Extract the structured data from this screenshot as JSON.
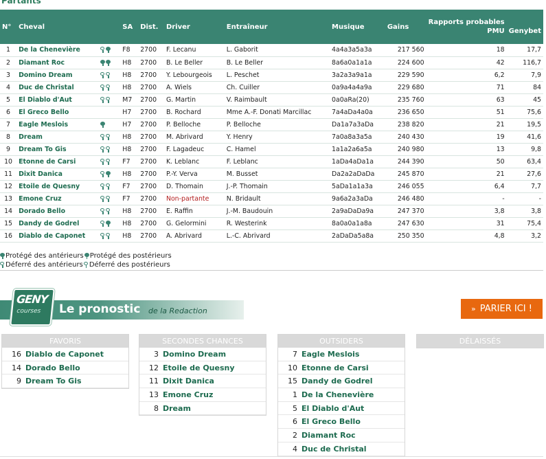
{
  "section_title": "Partants",
  "headers": {
    "num": "N°",
    "name": "Cheval",
    "sa": "SA",
    "dist": "Dist.",
    "driver": "Driver",
    "trainer": "Entraîneur",
    "musique": "Musique",
    "gains": "Gains",
    "rapports": "Rapports probables",
    "pmu": "PMU",
    "genybet": "Genybet"
  },
  "runners": [
    {
      "num": "1",
      "name": "De la Chenevière",
      "icons": "dep",
      "sa": "F8",
      "dist": "2700",
      "driver": "F. Lecanu",
      "trainer": "L. Gaborit",
      "musique": "4a4a3a5a3a",
      "gains": "217 560",
      "pmu": "18",
      "geny": "17,7"
    },
    {
      "num": "2",
      "name": "Diamant Roc",
      "icons": "pp",
      "sa": "H8",
      "dist": "2700",
      "driver": "B. Le Beller",
      "trainer": "B. Le Beller",
      "musique": "8a6a0a1a1a",
      "gains": "224 600",
      "pmu": "42",
      "geny": "116,7"
    },
    {
      "num": "3",
      "name": "Domino Dream",
      "icons": "dd",
      "sa": "H8",
      "dist": "2700",
      "driver": "Y. Lebourgeois",
      "trainer": "L. Peschet",
      "musique": "3a2a3a9a1a",
      "gains": "229 590",
      "pmu": "6,2",
      "geny": "7,9"
    },
    {
      "num": "4",
      "name": "Duc de Christal",
      "icons": "dd",
      "sa": "H8",
      "dist": "2700",
      "driver": "A. Wiels",
      "trainer": "Ch. Cuiller",
      "musique": "0a9a4a4a9a",
      "gains": "229 680",
      "pmu": "71",
      "geny": "84"
    },
    {
      "num": "5",
      "name": "El Diablo d'Aut",
      "icons": "dd",
      "sa": "M7",
      "dist": "2700",
      "driver": "G. Martin",
      "trainer": "V. Raimbault",
      "musique": "0a0aRa(20)",
      "gains": "235 760",
      "pmu": "63",
      "geny": "45"
    },
    {
      "num": "6",
      "name": "El Greco Bello",
      "icons": "",
      "sa": "H7",
      "dist": "2700",
      "driver": "B. Rochard",
      "trainer": "Mme A.-F. Donati Marcillac",
      "musique": "7a4aDa4a0a",
      "gains": "236 650",
      "pmu": "51",
      "geny": "75,6"
    },
    {
      "num": "7",
      "name": "Eagle Meslois",
      "icons": "p",
      "sa": "H7",
      "dist": "2700",
      "driver": "P. Belloche",
      "trainer": "P. Belloche",
      "musique": "Da1a7a3aDa",
      "gains": "238 820",
      "pmu": "21",
      "geny": "19,5"
    },
    {
      "num": "8",
      "name": "Dream",
      "icons": "dd",
      "sa": "H8",
      "dist": "2700",
      "driver": "M. Abrivard",
      "trainer": "Y. Henry",
      "musique": "7a0a8a3a5a",
      "gains": "240 430",
      "pmu": "19",
      "geny": "41,6"
    },
    {
      "num": "9",
      "name": "Dream To Gis",
      "icons": "dd",
      "sa": "H8",
      "dist": "2700",
      "driver": "F. Lagadeuc",
      "trainer": "C. Hamel",
      "musique": "1a1a2a6a5a",
      "gains": "240 980",
      "pmu": "13",
      "geny": "9,8"
    },
    {
      "num": "10",
      "name": "Etonne de Carsi",
      "icons": "dd",
      "sa": "F7",
      "dist": "2700",
      "driver": "K. Leblanc",
      "trainer": "F. Leblanc",
      "musique": "1aDa4aDa1a",
      "gains": "244 390",
      "pmu": "50",
      "geny": "63,4"
    },
    {
      "num": "11",
      "name": "Dixit Danica",
      "icons": "dp",
      "sa": "H8",
      "dist": "2700",
      "driver": "P.-Y. Verva",
      "trainer": "M. Busset",
      "musique": "Da2a2aDaDa",
      "gains": "245 870",
      "pmu": "21",
      "geny": "27,6"
    },
    {
      "num": "12",
      "name": "Etoile de Quesny",
      "icons": "dd",
      "sa": "F7",
      "dist": "2700",
      "driver": "D. Thomain",
      "trainer": "J.-P. Thomain",
      "musique": "5aDa1a1a3a",
      "gains": "246 055",
      "pmu": "6,4",
      "geny": "7,7"
    },
    {
      "num": "13",
      "name": "Emone Cruz",
      "icons": "dd",
      "sa": "F7",
      "dist": "2700",
      "driver": "Non-partante",
      "trainer": "N. Bridault",
      "musique": "9a6a2a3aDa",
      "gains": "246 480",
      "pmu": "-",
      "geny": "-"
    },
    {
      "num": "14",
      "name": "Dorado Bello",
      "icons": "dd",
      "sa": "H8",
      "dist": "2700",
      "driver": "E. Raffin",
      "trainer": "J.-M. Baudouin",
      "musique": "2a9aDaDa9a",
      "gains": "247 370",
      "pmu": "3,8",
      "geny": "3,8"
    },
    {
      "num": "15",
      "name": "Dandy de Godrel",
      "icons": "dp",
      "sa": "H8",
      "dist": "2700",
      "driver": "G. Gelormini",
      "trainer": "R. Westerink",
      "musique": "8a0a0a1a8a",
      "gains": "247 630",
      "pmu": "31",
      "geny": "75,4"
    },
    {
      "num": "16",
      "name": "Diablo de Caponet",
      "icons": "dd",
      "sa": "H8",
      "dist": "2700",
      "driver": "A. Abrivard",
      "trainer": "L.-C. Abrivard",
      "musique": "2aDaDa5a8a",
      "gains": "250 350",
      "pmu": "4,8",
      "geny": "3,2"
    }
  ],
  "legend": {
    "protege_ant": "Protégé des antérieurs",
    "protege_post": "Protégé des postérieurs",
    "deferre_ant": "Déferré des antérieurs",
    "deferre_post": "Déferré des postérieurs"
  },
  "pronostic": {
    "logo_line1": "GENY",
    "logo_line2": "courses",
    "title": "Le pronostic",
    "subtitle": "de la Redaction",
    "bet_button": "PARIER ICI !"
  },
  "boxes": [
    {
      "title": "FAVORIS",
      "items": [
        {
          "n": "16",
          "h": "Diablo de Caponet"
        },
        {
          "n": "14",
          "h": "Dorado Bello"
        },
        {
          "n": "9",
          "h": "Dream To Gis"
        }
      ]
    },
    {
      "title": "SECONDES CHANCES",
      "items": [
        {
          "n": "3",
          "h": "Domino Dream"
        },
        {
          "n": "12",
          "h": "Etoile de Quesny"
        },
        {
          "n": "11",
          "h": "Dixit Danica"
        },
        {
          "n": "13",
          "h": "Emone Cruz"
        },
        {
          "n": "8",
          "h": "Dream"
        }
      ]
    },
    {
      "title": "OUTSIDERS",
      "items": [
        {
          "n": "7",
          "h": "Eagle Meslois"
        },
        {
          "n": "10",
          "h": "Etonne de Carsi"
        },
        {
          "n": "15",
          "h": "Dandy de Godrel"
        },
        {
          "n": "1",
          "h": "De la Chenevière"
        },
        {
          "n": "5",
          "h": "El Diablo d'Aut"
        },
        {
          "n": "6",
          "h": "El Greco Bello"
        },
        {
          "n": "2",
          "h": "Diamant Roc"
        },
        {
          "n": "4",
          "h": "Duc de Christal"
        }
      ]
    },
    {
      "title": "DÉLAISSÉS",
      "items": []
    }
  ]
}
